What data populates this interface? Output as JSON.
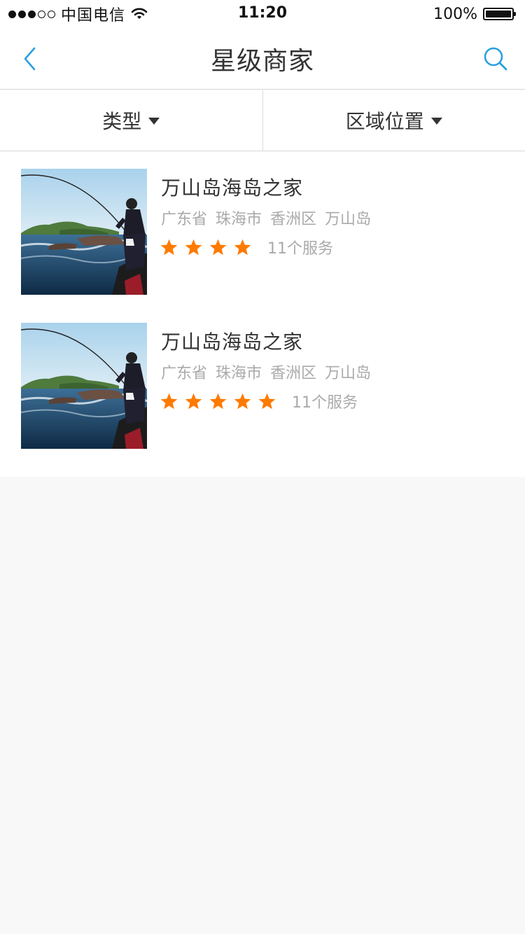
{
  "status_bar": {
    "carrier": "中国电信",
    "time": "11:20",
    "battery": "100%",
    "signal_bars_filled": 3,
    "signal_bars_total": 5
  },
  "nav": {
    "title": "星级商家",
    "back_icon": "chevron-left-icon",
    "search_icon": "search-icon",
    "accent_color": "#2a9fe0"
  },
  "filters": [
    {
      "label": "类型",
      "icon": "caret-down-icon"
    },
    {
      "label": "区域位置",
      "icon": "caret-down-icon"
    }
  ],
  "shops": [
    {
      "name": "万山岛海岛之家",
      "address": [
        "广东省",
        "珠海市",
        "香洲区",
        "万山岛"
      ],
      "stars": 4,
      "services": "11个服务"
    },
    {
      "name": "万山岛海岛之家",
      "address": [
        "广东省",
        "珠海市",
        "香洲区",
        "万山岛"
      ],
      "stars": 5,
      "services": "11个服务"
    }
  ],
  "colors": {
    "star": "#ff7a00",
    "secondary_text": "#aaaaaa",
    "background": "#f8f8f8"
  }
}
